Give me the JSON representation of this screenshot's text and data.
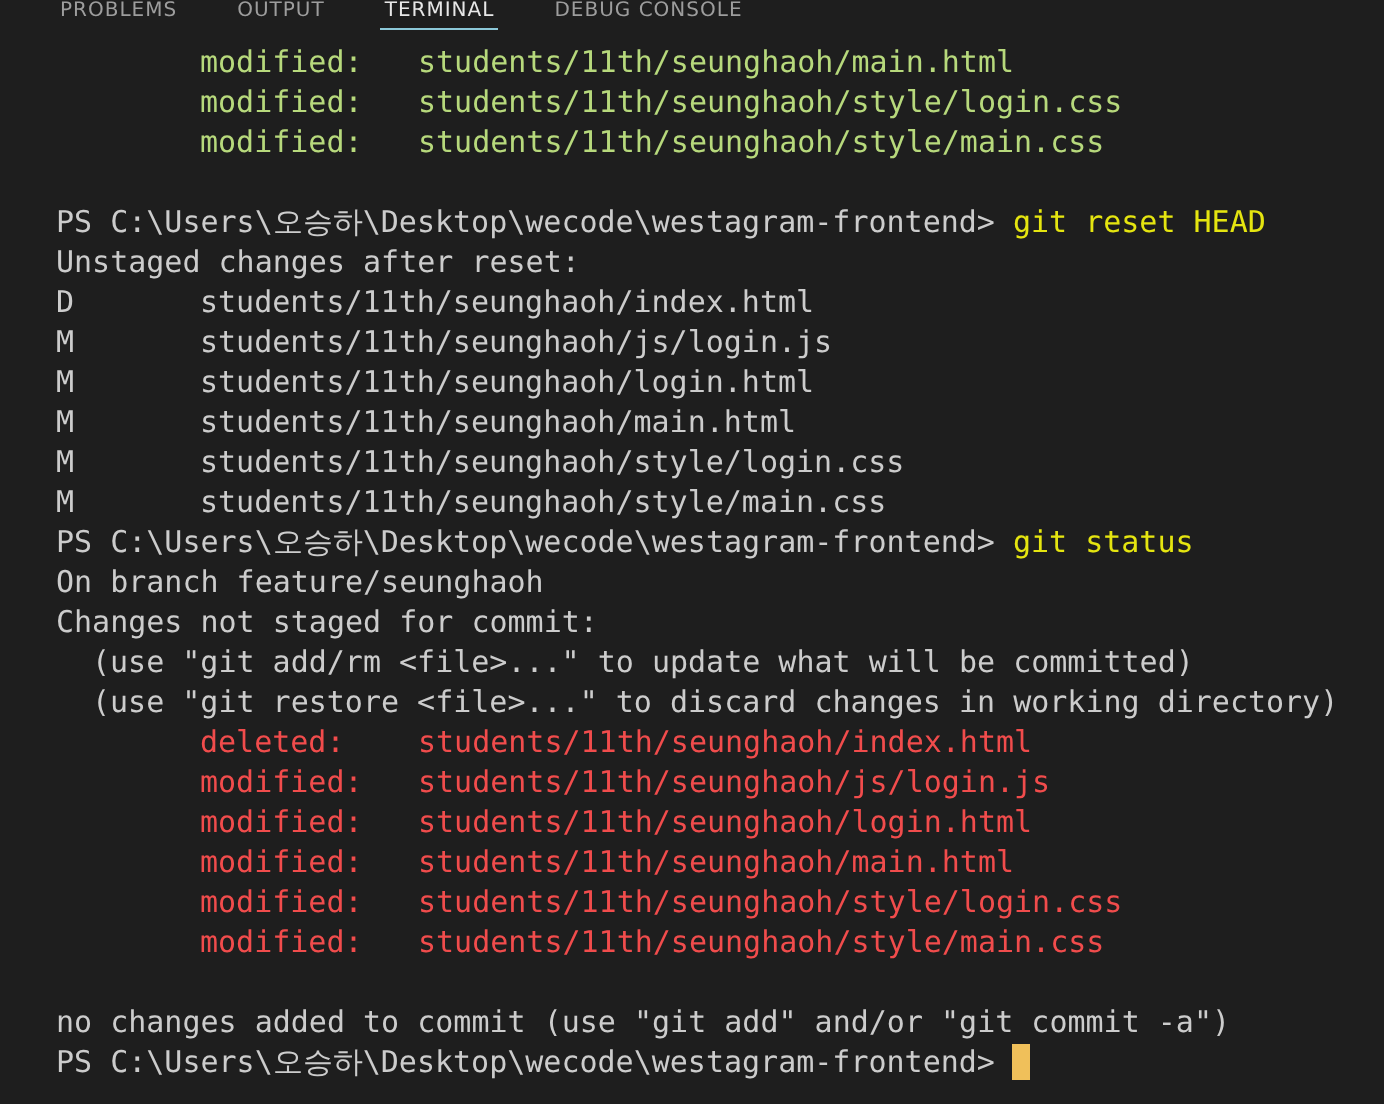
{
  "tabs": [
    {
      "label": "PROBLEMS",
      "selected": false
    },
    {
      "label": "OUTPUT",
      "selected": false
    },
    {
      "label": "TERMINAL",
      "selected": true
    },
    {
      "label": "DEBUG CONSOLE",
      "selected": false
    }
  ],
  "terminal": {
    "lines": [
      {
        "kind": "file",
        "status": "modified:",
        "path": "students/11th/seunghaoh/main.html",
        "staged": true
      },
      {
        "kind": "file",
        "status": "modified:",
        "path": "students/11th/seunghaoh/style/login.css",
        "staged": true
      },
      {
        "kind": "file",
        "status": "modified:",
        "path": "students/11th/seunghaoh/style/main.css",
        "staged": true
      },
      {
        "kind": "blank"
      },
      {
        "kind": "prompt",
        "prompt": "PS C:\\Users\\오승하\\Desktop\\wecode\\westagram-frontend>",
        "command": "git reset HEAD",
        "cursor": false
      },
      {
        "kind": "text",
        "text": "Unstaged changes after reset:"
      },
      {
        "kind": "reset",
        "status": "D",
        "path": "students/11th/seunghaoh/index.html"
      },
      {
        "kind": "reset",
        "status": "M",
        "path": "students/11th/seunghaoh/js/login.js"
      },
      {
        "kind": "reset",
        "status": "M",
        "path": "students/11th/seunghaoh/login.html"
      },
      {
        "kind": "reset",
        "status": "M",
        "path": "students/11th/seunghaoh/main.html"
      },
      {
        "kind": "reset",
        "status": "M",
        "path": "students/11th/seunghaoh/style/login.css"
      },
      {
        "kind": "reset",
        "status": "M",
        "path": "students/11th/seunghaoh/style/main.css"
      },
      {
        "kind": "prompt",
        "prompt": "PS C:\\Users\\오승하\\Desktop\\wecode\\westagram-frontend>",
        "command": "git status",
        "cursor": false
      },
      {
        "kind": "text",
        "text": "On branch feature/seunghaoh"
      },
      {
        "kind": "text",
        "text": "Changes not staged for commit:"
      },
      {
        "kind": "hint",
        "text": "(use \"git add/rm <file>...\" to update what will be committed)"
      },
      {
        "kind": "hint",
        "text": "(use \"git restore <file>...\" to discard changes in working directory)"
      },
      {
        "kind": "file",
        "status": "deleted:",
        "path": "students/11th/seunghaoh/index.html",
        "staged": false
      },
      {
        "kind": "file",
        "status": "modified:",
        "path": "students/11th/seunghaoh/js/login.js",
        "staged": false
      },
      {
        "kind": "file",
        "status": "modified:",
        "path": "students/11th/seunghaoh/login.html",
        "staged": false
      },
      {
        "kind": "file",
        "status": "modified:",
        "path": "students/11th/seunghaoh/main.html",
        "staged": false
      },
      {
        "kind": "file",
        "status": "modified:",
        "path": "students/11th/seunghaoh/style/login.css",
        "staged": false
      },
      {
        "kind": "file",
        "status": "modified:",
        "path": "students/11th/seunghaoh/style/main.css",
        "staged": false
      },
      {
        "kind": "blank"
      },
      {
        "kind": "text",
        "text": "no changes added to commit (use \"git add\" and/or \"git commit -a\")"
      },
      {
        "kind": "prompt",
        "prompt": "PS C:\\Users\\오승하\\Desktop\\wecode\\westagram-frontend>",
        "cursor": true
      }
    ]
  }
}
